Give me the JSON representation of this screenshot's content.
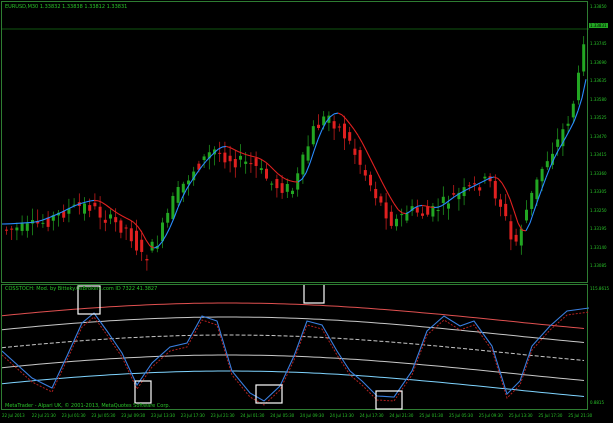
{
  "chart_header": {
    "symbol_line": "EURUSD,M30  1.33832 1.33838 1.33812 1.33831"
  },
  "indicator_header": {
    "title": "COSSTOCH: Mod. by Bitteky.OsBrokers.com ID 7322 41.3827"
  },
  "footer": {
    "credit": "MetaTrader - Alpari UK, © 2001-2013, MetaQuotes Software Corp."
  },
  "price_axis": {
    "ticks": [
      "1.33850",
      "1.33798",
      "1.33745",
      "1.33690",
      "1.33635",
      "1.33580",
      "1.33525",
      "1.33470",
      "1.33415",
      "1.33360",
      "1.33305",
      "1.33250",
      "1.33195",
      "1.33140",
      "1.33085"
    ],
    "current_price": "1.33831"
  },
  "indicator_axis": {
    "top": "115.8615",
    "bottom": "0.8815"
  },
  "time_axis": {
    "labels": [
      "22 Jul 2013",
      "22 Jul 21:30",
      "23 Jul 01:30",
      "23 Jul 05:30",
      "23 Jul 09:30",
      "23 Jul 13:30",
      "23 Jul 17:30",
      "23 Jul 21:30",
      "24 Jul 01:30",
      "24 Jul 05:30",
      "24 Jul 09:30",
      "24 Jul 13:30",
      "24 Jul 17:30",
      "24 Jul 21:30",
      "25 Jul 01:30",
      "25 Jul 05:30",
      "25 Jul 09:30",
      "25 Jul 13:30",
      "25 Jul 17:30",
      "25 Jul 21:30"
    ]
  },
  "colors": {
    "background": "#000000",
    "frame": "#2e7d32",
    "text": "#29c429",
    "bull_candle": "#22a622",
    "bear_candle": "#e02020",
    "ma_up": "#2a8cff",
    "ma_down": "#e02020",
    "band_top": "#e05050",
    "band_mid": "#c8c8c8",
    "band_low": "#7fd4ff",
    "signal_line": "#3a7fe0",
    "signal_line_2": "#b02020",
    "highlight_box": "#ffffff"
  }
}
